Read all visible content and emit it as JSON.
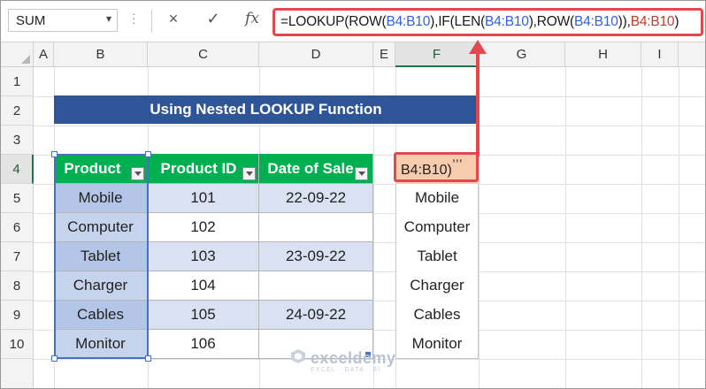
{
  "formula_bar": {
    "name_box": "SUM",
    "cancel_icon": "×",
    "enter_icon": "✓",
    "fx_label": "fx",
    "formula_parts": [
      {
        "t": "=LOOKUP(ROW(",
        "c": "n"
      },
      {
        "t": "B4:B10",
        "c": "b"
      },
      {
        "t": "),IF(LEN(",
        "c": "n"
      },
      {
        "t": "B4:B10",
        "c": "b"
      },
      {
        "t": "),ROW(",
        "c": "n"
      },
      {
        "t": "B4:B10",
        "c": "b"
      },
      {
        "t": ")),",
        "c": "n"
      },
      {
        "t": "B4:B10",
        "c": "r"
      },
      {
        "t": ")",
        "c": "n"
      }
    ]
  },
  "columns": [
    "A",
    "B",
    "C",
    "D",
    "E",
    "F",
    "G",
    "H",
    "I"
  ],
  "rows": [
    "1",
    "2",
    "3",
    "4",
    "5",
    "6",
    "7",
    "8",
    "9",
    "10"
  ],
  "title": "Using Nested LOOKUP Function",
  "table": {
    "headers": [
      "Product",
      "Product ID",
      "Date of Sale"
    ],
    "rows": [
      {
        "product": "Mobile",
        "id": "101",
        "date": "22-09-22"
      },
      {
        "product": "Computer",
        "id": "102",
        "date": ""
      },
      {
        "product": "Tablet",
        "id": "103",
        "date": "23-09-22"
      },
      {
        "product": "Charger",
        "id": "104",
        "date": ""
      },
      {
        "product": "Cables",
        "id": "105",
        "date": "24-09-22"
      },
      {
        "product": "Monitor",
        "id": "106",
        "date": ""
      }
    ]
  },
  "active_cell": {
    "line1": ",,,",
    "line2": "B4:B10)"
  },
  "results": [
    "Mobile",
    "Computer",
    "Tablet",
    "Charger",
    "Cables",
    "Monitor"
  ],
  "watermark": {
    "name": "exceldemy",
    "tagline": "EXCEL · DATA · BI"
  },
  "colors": {
    "title_bg": "#2e5597",
    "header_bg": "#00b050",
    "row_blue": "#d9e1f2",
    "highlight": "#e1494e",
    "active_fill": "#f8cbad"
  }
}
